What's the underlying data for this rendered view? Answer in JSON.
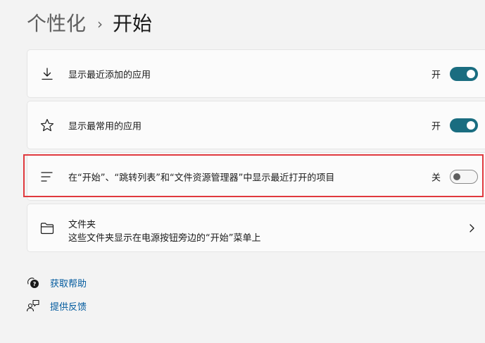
{
  "breadcrumb": {
    "parent": "个性化",
    "separator": "›",
    "current": "开始"
  },
  "settings": [
    {
      "label": "显示最近添加的应用",
      "state": "开",
      "on": true,
      "icon": "download-icon"
    },
    {
      "label": "显示最常用的应用",
      "state": "开",
      "on": true,
      "icon": "star-icon"
    },
    {
      "label": "在“开始”、“跳转列表”和“文件资源管理器”中显示最近打开的项目",
      "state": "关",
      "on": false,
      "icon": "list-icon"
    }
  ],
  "folders": {
    "title": "文件夹",
    "subtitle": "这些文件夹显示在电源按钮旁边的“开始”菜单上",
    "icon": "folder-icon"
  },
  "links": {
    "help": "获取帮助",
    "feedback": "提供反馈"
  },
  "colors": {
    "accent": "#1a6d80",
    "highlight": "#e0393e",
    "link": "#005a9e"
  }
}
